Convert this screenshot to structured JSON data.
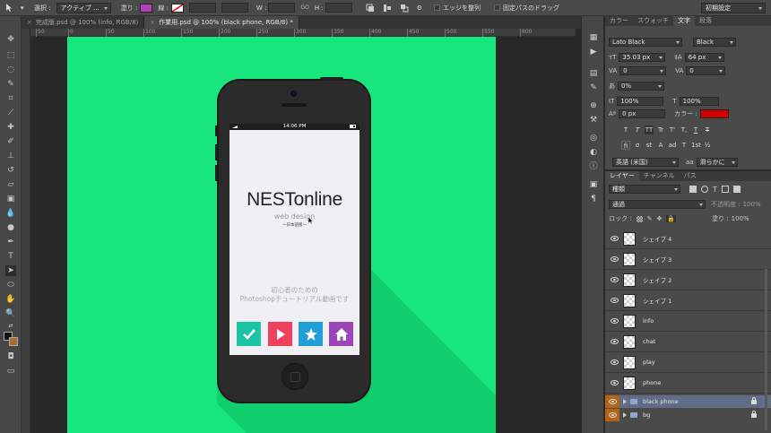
{
  "options_bar": {
    "select_label": "選択 :",
    "select_value": "アクティブ ...",
    "fill_label": "塗り :",
    "fill_color": "#b43fbf",
    "stroke_label": "線 :",
    "w_label": "W :",
    "h_label": "H :",
    "go_label": "GO",
    "edge_align": "エッジを整列",
    "fixed_path": "固定パスのドラッグ",
    "workspace": "初期設定"
  },
  "doc_tabs": [
    {
      "label": "完成版.psd @ 100% (info, RGB/8)"
    },
    {
      "label": "作業用.psd @ 100% (black phone, RGB/8) *"
    }
  ],
  "ruler": {
    "ticks": [
      "50",
      "0",
      "50",
      "100",
      "150",
      "200",
      "250",
      "300",
      "350",
      "400",
      "450",
      "500",
      "550",
      "600"
    ]
  },
  "phone": {
    "status_time": "14:06 PM",
    "brand": "NESTonline",
    "subtitle": "web design",
    "subnote": "〜日本語版〜",
    "tagline1": "初心者のための",
    "tagline2": "Photoshopチュートリアル動画です",
    "buttons": [
      {
        "name": "check",
        "color": "#1bc4a3"
      },
      {
        "name": "play",
        "color": "#f0415c"
      },
      {
        "name": "star",
        "color": "#1f9ed8"
      },
      {
        "name": "home",
        "color": "#9b45b8"
      }
    ]
  },
  "character_panel": {
    "tabs": [
      "カラー",
      "スウォッチ",
      "文字",
      "段落"
    ],
    "active_tab": "文字",
    "font_family": "Lato Black",
    "font_style": "Black",
    "font_size": "35.03 px",
    "leading": "64 px",
    "kerning": "0",
    "tracking": "0",
    "scale_pct": "0%",
    "vertical_scale": "100%",
    "horizontal_scale": "100%",
    "baseline_shift": "0 px",
    "color_label": "カラー :",
    "color_value": "#d40000",
    "type_buttons": [
      "T",
      "T",
      "TT",
      "Tr",
      "T'",
      "T,",
      "T",
      "T"
    ],
    "ot_buttons": [
      "fi",
      "σ",
      "st",
      "A",
      "ad",
      "T",
      "1st",
      "½"
    ],
    "language": "英語 (米国)",
    "aa_label": "aa",
    "antialias": "滑らかに"
  },
  "layers_panel": {
    "tabs": [
      "レイヤー",
      "チャンネル",
      "パス"
    ],
    "filter_kind": "種類",
    "blend_mode": "通過",
    "opacity_label": "不透明度 :",
    "opacity_value": "100%",
    "lock_label": "ロック :",
    "fill_label": "塗り :",
    "fill_value": "100%",
    "layers": [
      "シェイプ 4",
      "シェイプ 3",
      "シェイプ 2",
      "シェイプ 1",
      "info",
      "chat",
      "play",
      "phone"
    ],
    "groups": [
      {
        "name": "black phone",
        "selected": true
      },
      {
        "name": "bg",
        "selected": false
      }
    ]
  }
}
